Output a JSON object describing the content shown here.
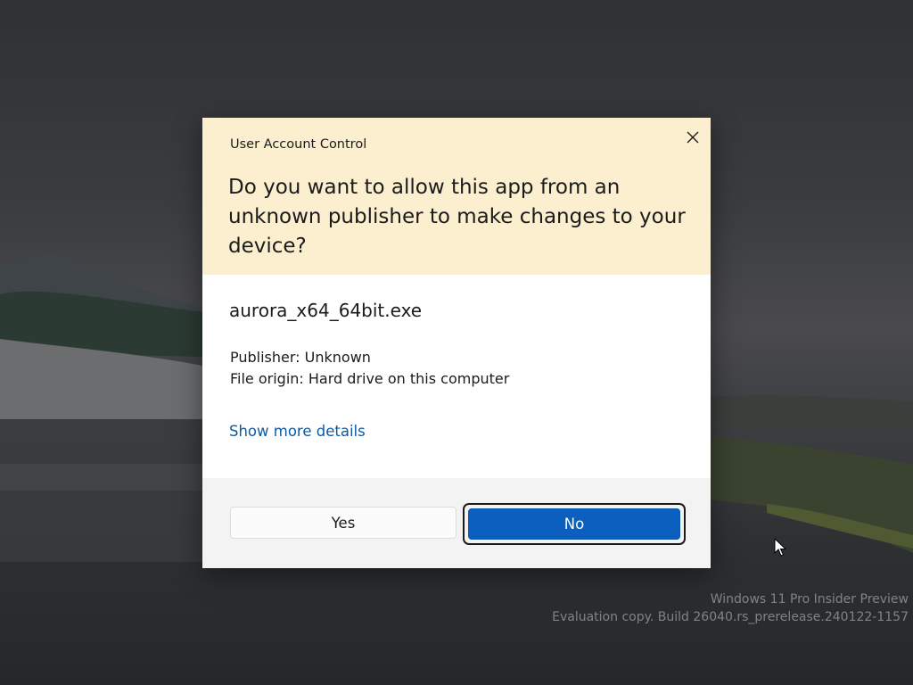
{
  "dialog": {
    "title": "User Account Control",
    "question": "Do you want to allow this app from an unknown publisher to make changes to your device?",
    "app_name": "aurora_x64_64bit.exe",
    "publisher": "Publisher: Unknown",
    "file_origin": "File origin: Hard drive on this computer",
    "details_link": "Show more details",
    "yes_label": "Yes",
    "no_label": "No",
    "close_icon": "close-icon"
  },
  "watermark": {
    "line1": "Windows 11 Pro Insider Preview",
    "line2": "Evaluation copy. Build 26040.rs_prerelease.240122-1157"
  },
  "colors": {
    "header_bg": "#fcefcf",
    "accent": "#0a5fbf",
    "link": "#0f5aa0",
    "footer_bg": "#f3f3f3"
  }
}
